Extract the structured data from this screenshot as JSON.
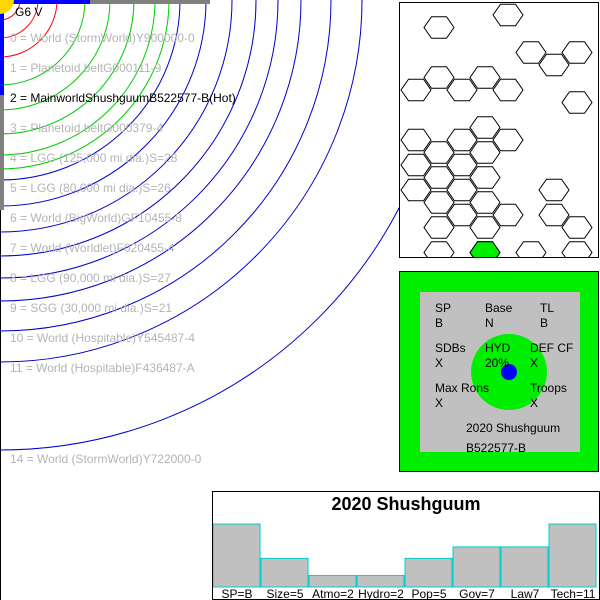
{
  "star": {
    "label": "G6 V",
    "color": "#ffd700"
  },
  "orbits": [
    {
      "label": "0 = World  (StormWorld)Y900000-0",
      "type": "normal"
    },
    {
      "label": "1 = Planetoid beltG000111-9",
      "type": "normal"
    },
    {
      "label": "2 = MainworldShushguumB522577-B(Hot)",
      "type": "main"
    },
    {
      "label": "3 = Planetoid beltG000379-4",
      "type": "normal"
    },
    {
      "label": "4 = LGG (125,000 mi dia.)S=28",
      "type": "normal"
    },
    {
      "label": "5 = LGG (80,000 mi dia.)S=26",
      "type": "normal"
    },
    {
      "label": "6 = World  (BigWorld)GF10455-8",
      "type": "normal"
    },
    {
      "label": "7 = World  (Worldlet)F020455-4",
      "type": "normal"
    },
    {
      "label": "8 = LGG (90,000 mi dia.)S=27",
      "type": "normal"
    },
    {
      "label": "9 = SGG (30,000 mi dia.)S=21",
      "type": "normal"
    },
    {
      "label": "10 = World  (Hospitable)Y545487-4",
      "type": "normal"
    },
    {
      "label": "11 = World  (Hospitable)F436487-A",
      "type": "normal"
    },
    {
      "label": "14 = World  (StormWorld)Y722000-0",
      "type": "normal"
    }
  ],
  "colors": {
    "orbit_inner": "#ff0000",
    "orbit_habitable": "#00cc00",
    "orbit_outer": "#0000cc",
    "hex_highlight": "#00ee00",
    "panel_green": "#00ee00",
    "panel_gray": "#c0c0c0",
    "bar_fill": "#c0c0c0",
    "bar_stroke": "#00cccc"
  },
  "uwp_panel": {
    "sp_label": "SP",
    "sp_value": "B",
    "base_label": "Base",
    "base_value": "N",
    "tl_label": "TL",
    "tl_value": "B",
    "sdbs_label": "SDBs",
    "sdbs_value": "X",
    "hyd_label": "HYD",
    "hyd_value": "20%",
    "def_label": "DEF CF",
    "def_value": "X",
    "maxrons_label": "Max Rons",
    "maxrons_value": "X",
    "troops_label": "Troops",
    "troops_value": "X",
    "year_name": "2020 Shushguum",
    "uwp_code": "B522577-B"
  },
  "chart_data": {
    "type": "bar",
    "title": "2020 Shushguum",
    "categories": [
      "SP=B",
      "Size=5",
      "Atmo=2",
      "Hydro=2",
      "Pop=5",
      "Gov=7",
      "Law7",
      "Tech=11"
    ],
    "values": [
      11,
      5,
      2,
      2,
      5,
      7,
      7,
      11
    ],
    "ylim": [
      0,
      11
    ]
  }
}
